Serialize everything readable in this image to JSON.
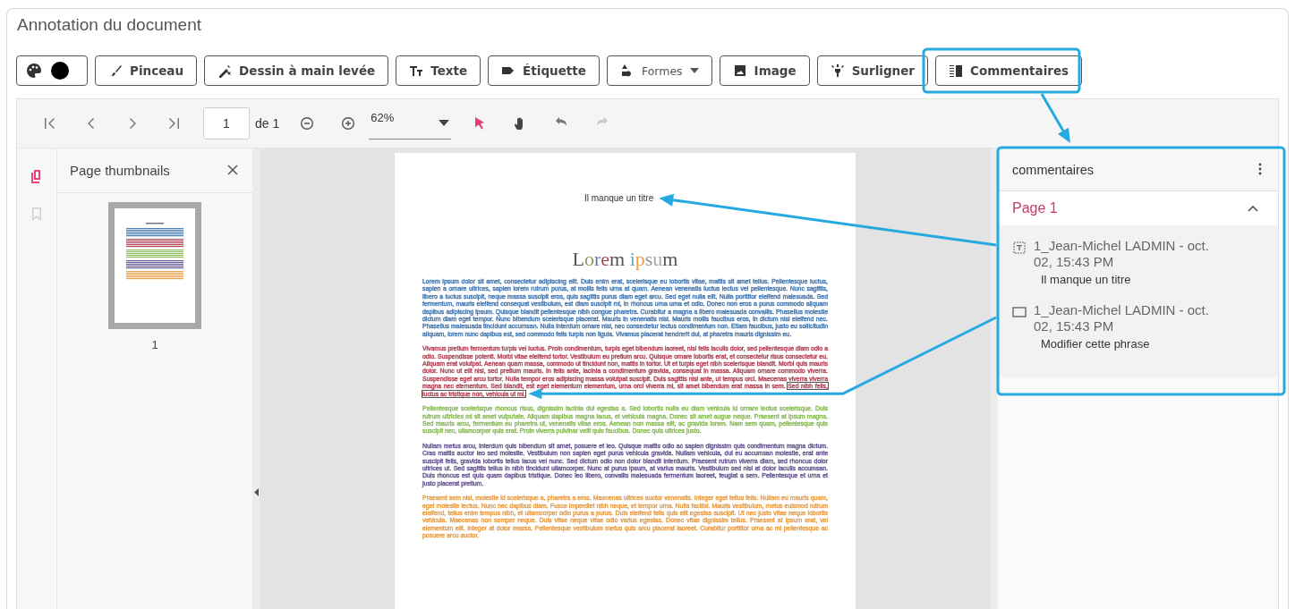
{
  "title": "Annotation du document",
  "tools": [
    {
      "kind": "color",
      "color": "#000000"
    },
    {
      "kind": "button",
      "label": "Pinceau"
    },
    {
      "kind": "button",
      "label": "Dessin à main levée"
    },
    {
      "kind": "button",
      "label": "Texte"
    },
    {
      "kind": "button",
      "label": "Étiquette"
    },
    {
      "kind": "dropdown",
      "label": "Formes"
    },
    {
      "kind": "button",
      "label": "Image"
    },
    {
      "kind": "button",
      "label": "Surligner"
    },
    {
      "kind": "button",
      "label": "Commentaires"
    }
  ],
  "viewer": {
    "page_input": "1",
    "page_total": "de 1",
    "zoom": "62%",
    "pointer_tool": {
      "selected": true
    },
    "hand_tool": {
      "selected": false
    },
    "redo": {
      "disabled": true
    }
  },
  "sidebar": {
    "tabs": [
      {
        "selected": true
      },
      {
        "selected": false
      }
    ],
    "title": "Page thumbnails",
    "thumbnails": [
      {
        "label": "1",
        "selected": true
      }
    ]
  },
  "document": {
    "annotation_text": "Il manque un titre",
    "heading": "Lorem ipsum",
    "paragraphs": [
      {
        "color": "#4b7cb3",
        "text": "Lorem ipsum dolor sit amet, consectetur adipiscing elit. Duis enim erat, scelerisque eu lobortis vitae, mattis sit amet tellus. Pellentesque luctus, sapien a ornare ultrices, sapien lorem rutrum purus, at mollis felis urna at quam. Aenean venenatis luctus lectus vel pellentesque. Nunc sagittis, libero a luctus suscipit, neque massa suscipit eros, quis sagittis purus diam eget arcu. Sed eget nulla elit. Nulla porttitor eleifend malesuada. Sed fermentum, mauris eleifend consequat vestibulum, est diam suscipit mi, in rhoncus urna urna et odio. Donec non eros a purus commodo aliquam dapibus adipiscing ipsum. Quisque blandit pellentesque nibh congue pharetra. Curabitur a magna a libero malesuada convallis. Phasellus molestie dictum diam eget tempor. Nunc bibendum scelerisque placerat. Mauris in venenatis nisi. Mauris mollis faucibus eros, in dictum nisi eleifend nec. Phasellus malesuada tincidunt accumsan. Nulla interdum ornare nisi, nec consectetur lectus condimentum non. Etiam faucibus, justo eu sollicitudin aliquam, lorem nunc dapibus est, sed commodo felis turpis non ligula. Vivamus placerat hendrerit dui, at pharetra mauris dignissim eu."
      },
      {
        "color": "#b54a5c",
        "text": "Vivamus pretium fermentum turpis vel luctus. Proin condimentum, turpis eget bibendum laoreet, nisi felis iaculis dolor, sed pellentesque diam odio a odio. Suspendisse potenti. Morbi vitae eleifend tortor. Vestibulum eu pretium arcu. Quisque ornare lobortis erat, et consectetur risus consectetur eu. Aliquam erat volutpat. Aenean quam massa, commodo ut tincidunt non, mattis in tortor. Ut et turpis eget nibh scelerisque blandit. Morbi quis mauris dolor. Nunc ut elit nisi, sed pretium mauris. In felis ante, lacinia a condimentum gravida, consequat in massa. Aliquam ornare commodo viverra. Suspendisse eget arcu tortor. Nulla tempor eros adipiscing massa volutpat suscipit. Duis sagittis nisl ante, ut tempus orci. Maecenas viverra viverra magna nec elementum. Sed blandit, est eget elementum elementum, urna orci viverra mi, sit amet bibendum erat massa in sem.",
        "boxed": "Sed nibh felis, luctus ac tristique non, vehicula ut mi."
      },
      {
        "color": "#8dbd5c",
        "text": "Pellentesque scelerisque rhoncus risus, dignissim lacinia dui egestas a. Sed lobortis nulla eu diam vehicula id ornare lectus scelerisque. Duis rutrum ultricies mi sit amet vulputate. Aliquam dapibus magna lacus, et vehicula magna. Donec sit amet augue neque. Praesent at ipsum magna. Sed mauris arcu, fermentum eu pharetra ut, venenatis vitae eros. Aenean non massa elit, ac gravida lorem. Nam sem quam, pellentesque quis suscipit nec, ullamcorper quis erat. Proin viverra pulvinar velit quis faucibus. Donec quis ultrices justo."
      },
      {
        "color": "#6b5b95",
        "text": "Nullam metus arcu, interdum quis bibendum sit amet, posuere et leo. Quisque mattis odio ac sapien dignissim quis condimentum magna dictum. Cras mattis auctor leo sed molestie. Vestibulum non sapien eget purus vehicula gravida. Nullam vehicula, dui eu accumsan molestie, erat ante suscipit felis, gravida lobortis tellus lacus vel nunc. Sed dictum odio non dolor blandit interdum. Praesent rutrum viverra diam, sed rhoncus dolor ultrices ut. Sed sagittis tellus in nibh tincidunt ullamcorper. Nunc at purus ipsum, at varius mauris. Vestibulum sed nisl at dolor iaculis accumsan. Duis rhoncus est quis quam dapibus tristique. Donec leo libero, convallis malesuada fermentum laoreet, feugiat a sem. Pellentesque et urna et justo placerat pretium."
      },
      {
        "color": "#e9a14c",
        "text": "Praesent sem nisl, molestie id scelerisque a, pharetra a eros. Maecenas ultrices auctor venenatis. Integer eget tellus felis. Nullam eu mauris quam, eget molestie lectus. Nunc nec dapibus diam. Fusce imperdiet nibh neque, et tempor urna. Nulla facilisi. Mauris vestibulum, metus euismod rutrum eleifend, tellus enim tempus nibh, et ullamcorper odio purus a purus. Duis eleifend felis quis elit egestas suscipit. Ut nec justo vitae neque lobortis vehicula. Maecenas non semper neque. Duis vitae neque vitae odio varius egestas. Donec vitae dignissim tellus. Praesent at ipsum erat, vel elementum elit. Integer at dolor massa. Pellentesque vestibulum metus quis arcu placerat laoreet. Curabitur porttitor urna ac mi pellentesque ac posuere arcu auctor."
      }
    ]
  },
  "comments": {
    "title": "commentaires",
    "groups": [
      {
        "label": "Page 1",
        "expanded": true,
        "items": [
          {
            "kind": "text",
            "author": "1_Jean-Michel LADMIN - oct. 02, 15:43 PM",
            "body": "Il manque un titre"
          },
          {
            "kind": "rectangle",
            "author": "1_Jean-Michel LADMIN - oct. 02, 15:43 PM",
            "body": "Modifier cette phrase"
          }
        ]
      }
    ]
  }
}
